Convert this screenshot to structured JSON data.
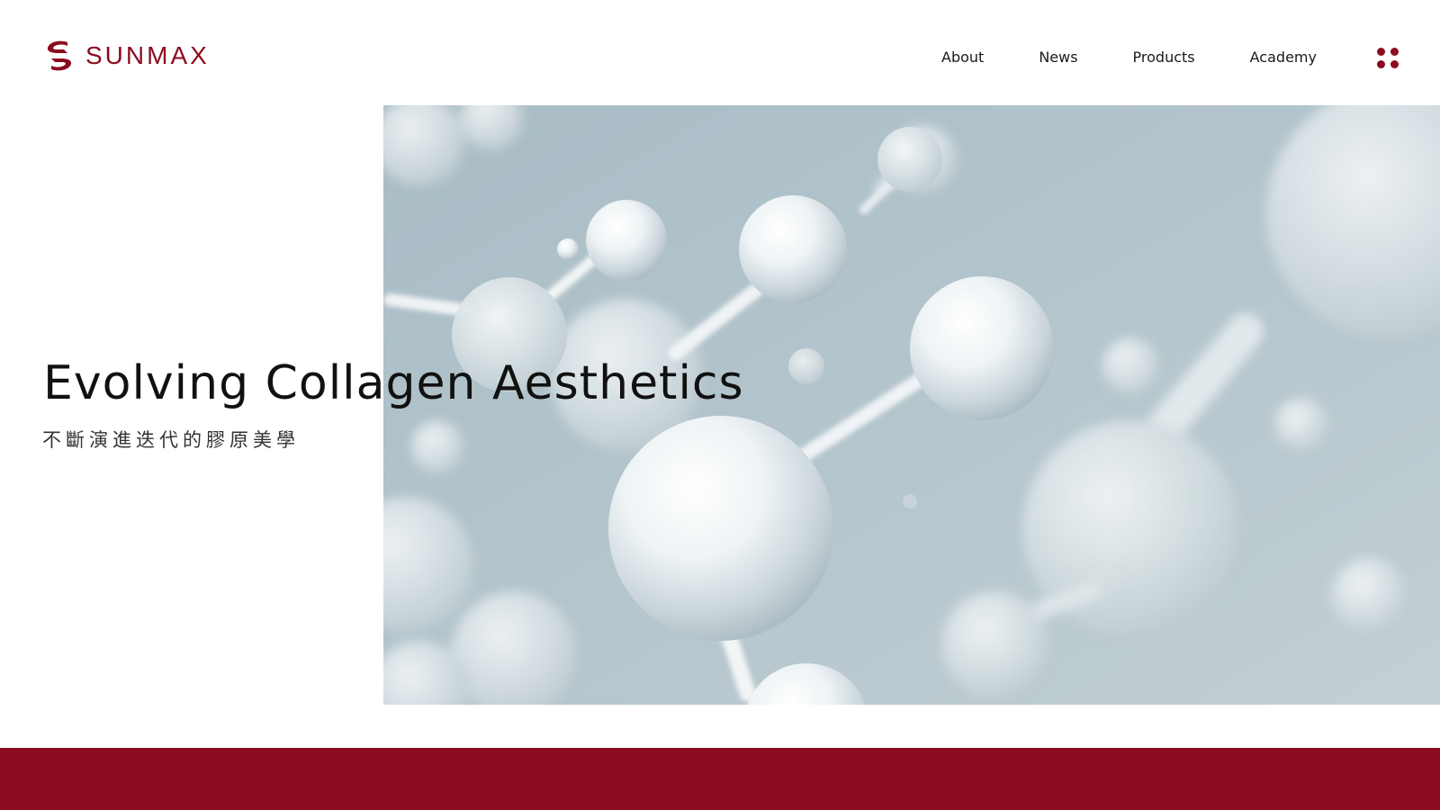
{
  "brand": {
    "name": "SUNMAX",
    "logo_icon": "sunmax-s-logo-icon",
    "color": "#8c0c1f"
  },
  "nav": {
    "items": [
      {
        "label": "About"
      },
      {
        "label": "News"
      },
      {
        "label": "Products"
      },
      {
        "label": "Academy"
      }
    ],
    "menu_icon": "dots-grid-menu-icon"
  },
  "hero": {
    "title": "Evolving Collagen Aesthetics",
    "subtitle": "不斷演進迭代的膠原美學",
    "image": "collagen-molecule-illustration",
    "image_bg": "#b4c4cc"
  },
  "footer": {
    "band_color": "#8c0c1f"
  }
}
